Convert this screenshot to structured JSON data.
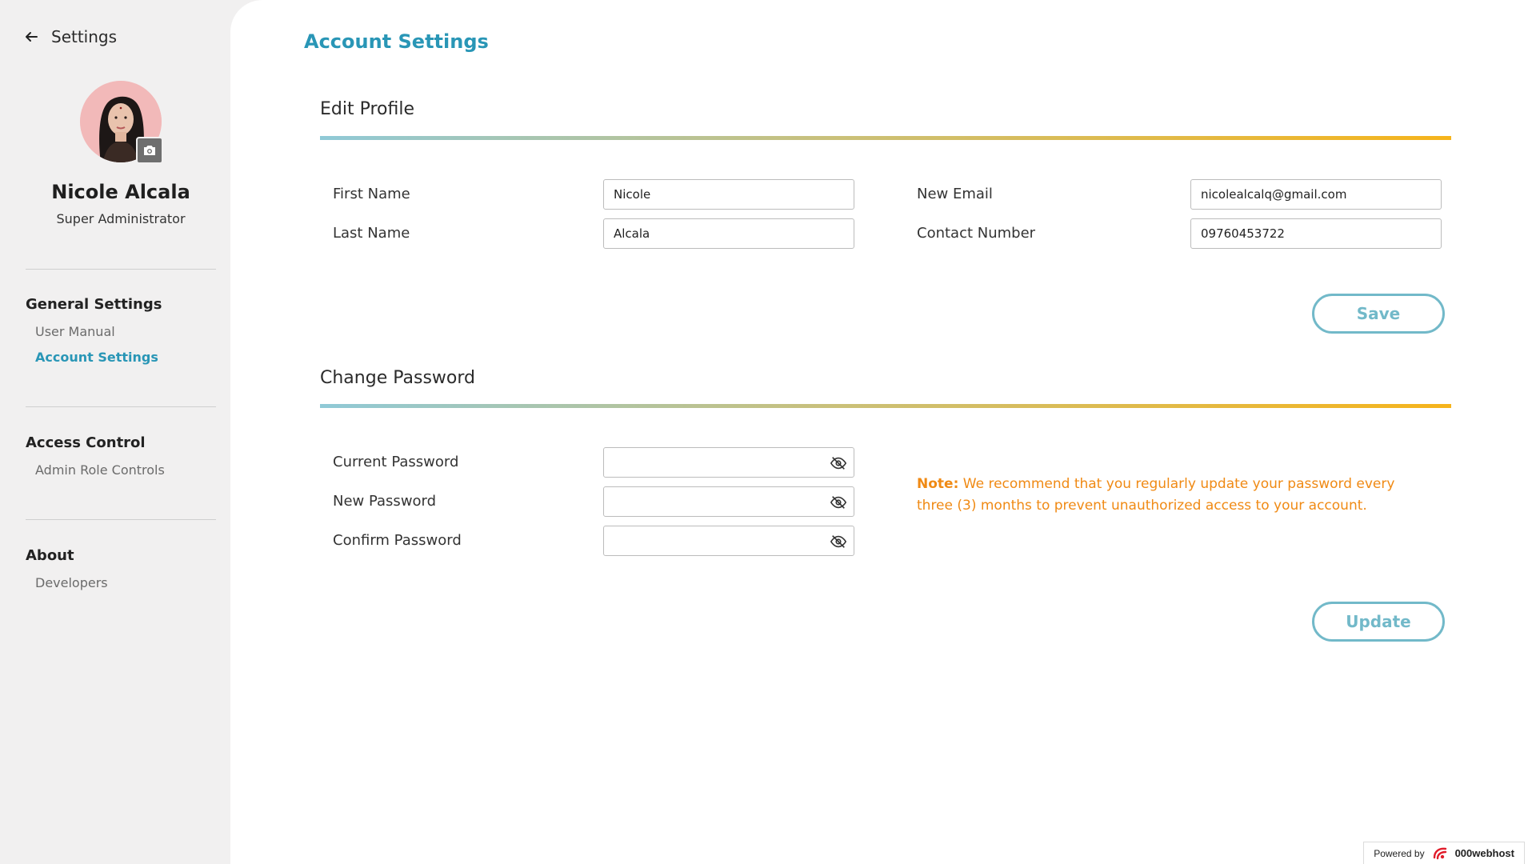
{
  "sidebar": {
    "back_label": "Settings",
    "user": {
      "name": "Nicole Alcala",
      "role": "Super Administrator"
    },
    "groups": [
      {
        "title": "General Settings",
        "items": [
          "User Manual",
          "Account Settings"
        ]
      },
      {
        "title": "Access Control",
        "items": [
          "Admin Role Controls"
        ]
      },
      {
        "title": "About",
        "items": [
          "Developers"
        ]
      }
    ],
    "active_item": "Account Settings"
  },
  "main": {
    "page_title": "Account Settings",
    "edit_profile": {
      "title": "Edit Profile",
      "first_name_label": "First Name",
      "first_name_value": "Nicole",
      "last_name_label": "Last Name",
      "last_name_value": "Alcala",
      "email_label": "New Email",
      "email_value": "nicolealcalq@gmail.com",
      "contact_label": "Contact Number",
      "contact_value": "09760453722",
      "save_label": "Save"
    },
    "change_password": {
      "title": "Change Password",
      "current_label": "Current Password",
      "new_label": "New Password",
      "confirm_label": "Confirm Password",
      "note_prefix": "Note:",
      "note_text": " We recommend that you regularly update your password every three (3) months to prevent unauthorized access to your account.",
      "update_label": "Update"
    }
  },
  "footer": {
    "powered_label": "Powered by",
    "brand": "000webhost"
  },
  "colors": {
    "accent": "#2996b6",
    "button_outline": "#72b9c9",
    "note": "#f08a14",
    "gradient_start": "#8fc9d7",
    "gradient_end": "#f6b41b"
  },
  "icons": {
    "back": "arrow-left-icon",
    "camera": "camera-icon",
    "password_toggle": "eye-off-icon",
    "brand_logo": "000webhost-logo-icon"
  }
}
